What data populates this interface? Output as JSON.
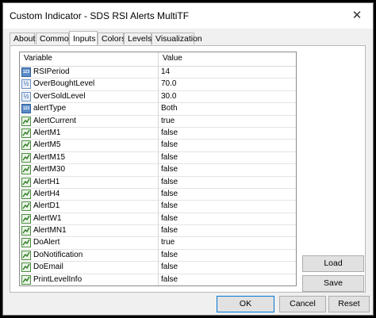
{
  "window": {
    "title": "Custom Indicator - SDS RSI Alerts MultiTF",
    "close_glyph": "✕"
  },
  "tabs": [
    "About",
    "Common",
    "Inputs",
    "Colors",
    "Levels",
    "Visualization"
  ],
  "active_tab": "Inputs",
  "grid": {
    "headers": {
      "variable": "Variable",
      "value": "Value"
    },
    "icon_text": {
      "int": "123",
      "dbl": "½"
    },
    "rows": [
      {
        "name": "RSIPeriod",
        "value": "14",
        "icon": "int"
      },
      {
        "name": "OverBoughtLevel",
        "value": "70.0",
        "icon": "dbl"
      },
      {
        "name": "OverSoldLevel",
        "value": "30.0",
        "icon": "dbl"
      },
      {
        "name": "alertType",
        "value": "Both",
        "icon": "int"
      },
      {
        "name": "AlertCurrent",
        "value": "true",
        "icon": "bool"
      },
      {
        "name": "AlertM1",
        "value": "false",
        "icon": "bool"
      },
      {
        "name": "AlertM5",
        "value": "false",
        "icon": "bool"
      },
      {
        "name": "AlertM15",
        "value": "false",
        "icon": "bool"
      },
      {
        "name": "AlertM30",
        "value": "false",
        "icon": "bool"
      },
      {
        "name": "AlertH1",
        "value": "false",
        "icon": "bool"
      },
      {
        "name": "AlertH4",
        "value": "false",
        "icon": "bool"
      },
      {
        "name": "AlertD1",
        "value": "false",
        "icon": "bool"
      },
      {
        "name": "AlertW1",
        "value": "false",
        "icon": "bool"
      },
      {
        "name": "AlertMN1",
        "value": "false",
        "icon": "bool"
      },
      {
        "name": "DoAlert",
        "value": "true",
        "icon": "bool"
      },
      {
        "name": "DoNotification",
        "value": "false",
        "icon": "bool"
      },
      {
        "name": "DoEmail",
        "value": "false",
        "icon": "bool"
      },
      {
        "name": "PrintLevelInfo",
        "value": "false",
        "icon": "bool"
      }
    ]
  },
  "buttons": {
    "load": "Load",
    "save": "Save",
    "ok": "OK",
    "cancel": "Cancel",
    "reset": "Reset"
  }
}
